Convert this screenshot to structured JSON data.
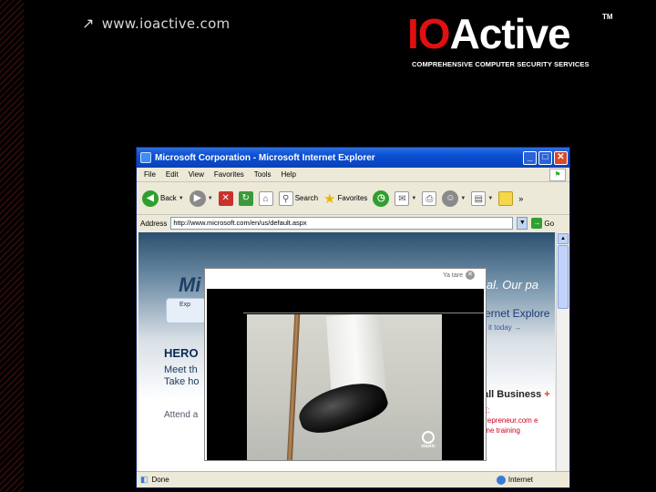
{
  "slide": {
    "site_url": "www.ioactive.com",
    "logo": {
      "brand_first": "IO",
      "brand_rest": "Active",
      "trademark": "TM",
      "tagline": "COMPREHENSIVE COMPUTER SECURITY SERVICES",
      "brand_colors": {
        "accent": "#e01010",
        "text": "#ffffff"
      }
    }
  },
  "browser": {
    "title": "Microsoft Corporation - Microsoft Internet Explorer",
    "window_controls": {
      "minimize": "_",
      "maximize": "□",
      "close": "✕"
    },
    "menu": [
      "File",
      "Edit",
      "View",
      "Favorites",
      "Tools",
      "Help"
    ],
    "toolbar": {
      "back_label": "Back",
      "search_label": "Search",
      "favorites_label": "Favorites",
      "overflow": "»"
    },
    "address": {
      "label": "Address",
      "value": "http://www.microsoft.com/en/us/default.aspx",
      "go_label": "Go"
    },
    "status": {
      "text": "Done",
      "zone": "Internet"
    }
  },
  "page": {
    "ms_logo": "Mi",
    "panel_text": "Exp",
    "hero_title": "HERO",
    "hero_sub_1": "Meet th",
    "hero_sub_2": "Take ho",
    "attend": "Attend a",
    "right_slogan": "ial. Our pa",
    "right_ie": "ernet Explore",
    "right_ie_sub": "it today →",
    "right_biz": "all Business",
    "right_biz_plus": "+",
    "right_lines": "E:\ntrepreneur.com e\nline training"
  },
  "popup": {
    "close_label": "Ya tare",
    "video_brand": "elastic"
  }
}
